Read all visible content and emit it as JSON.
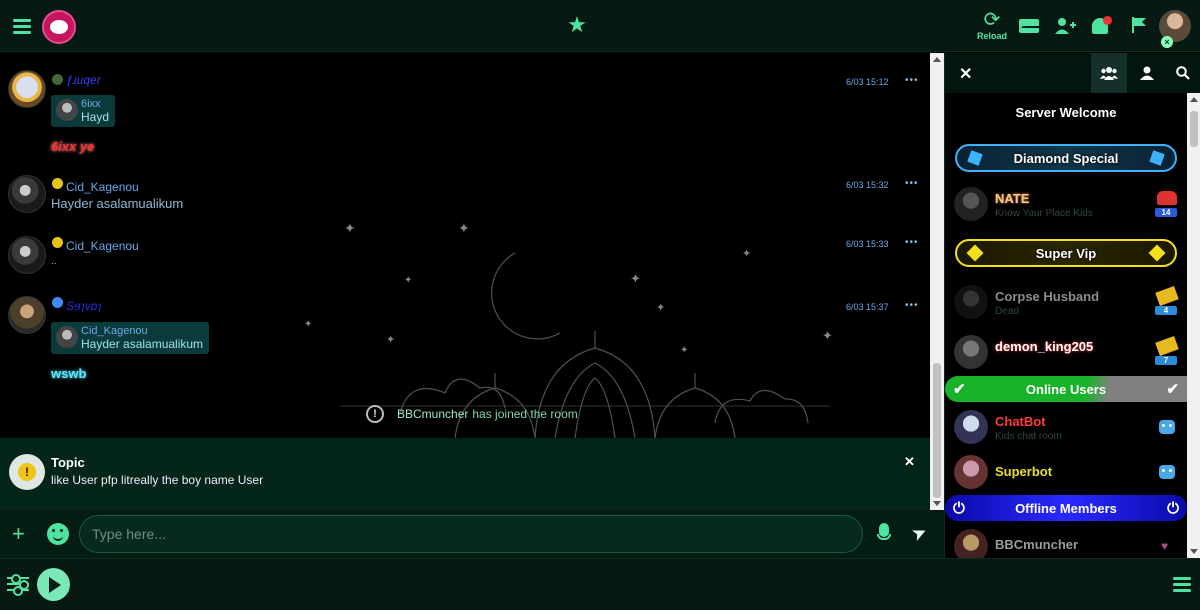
{
  "topbar": {
    "reload_label": "Reload"
  },
  "messages": [
    {
      "username": "ƒɹuqer",
      "quote_name": "6ixx",
      "quote_text": "Hayd",
      "text": "6ixx ye",
      "time": "6/03 15:12"
    },
    {
      "username": "Cid_Kagenou",
      "text": "Hayder asalamualikum",
      "time": "6/03 15:32"
    },
    {
      "username": "Cid_Kagenou",
      "text": "..",
      "time": "6/03 15:33"
    },
    {
      "username": "Sɘɿvɒɿ",
      "quote_name": "Cid_Kagenou",
      "quote_text": "Hayder asalamualikum",
      "text": "wswb",
      "time": "6/03 15:37"
    }
  ],
  "more_glyph": "•••",
  "system": {
    "who": "BBCmuncher",
    "what": "has joined the room"
  },
  "topic": {
    "title": "Topic",
    "text": "like User pfp litreally the boy name User"
  },
  "input": {
    "placeholder": "Type here..."
  },
  "panel": {
    "server_welcome": "Server Welcome",
    "diamond_label": "Diamond Special",
    "vip_label": "Super Vip",
    "online_label": "Online Users",
    "offline_label": "Offline Members",
    "diamond_users": [
      {
        "name": "NATE",
        "sub": "Know Your Place Kids",
        "level": "14"
      }
    ],
    "vip_users": [
      {
        "name": "Corpse Husband",
        "sub": "Dead",
        "level": "4"
      },
      {
        "name": "demon_king205",
        "sub": "",
        "level": "7"
      }
    ],
    "online_users": [
      {
        "name": "ChatBot",
        "sub": "Kids chat room"
      },
      {
        "name": "Superbot",
        "sub": ""
      }
    ],
    "offline_users": [
      {
        "name": "BBCmuncher"
      }
    ]
  },
  "colors": {
    "accent": "#4fe3a1",
    "topbar_bg": "#061a13",
    "chatbot_name": "#ff3b3b",
    "superbot_name": "#e8e020"
  }
}
